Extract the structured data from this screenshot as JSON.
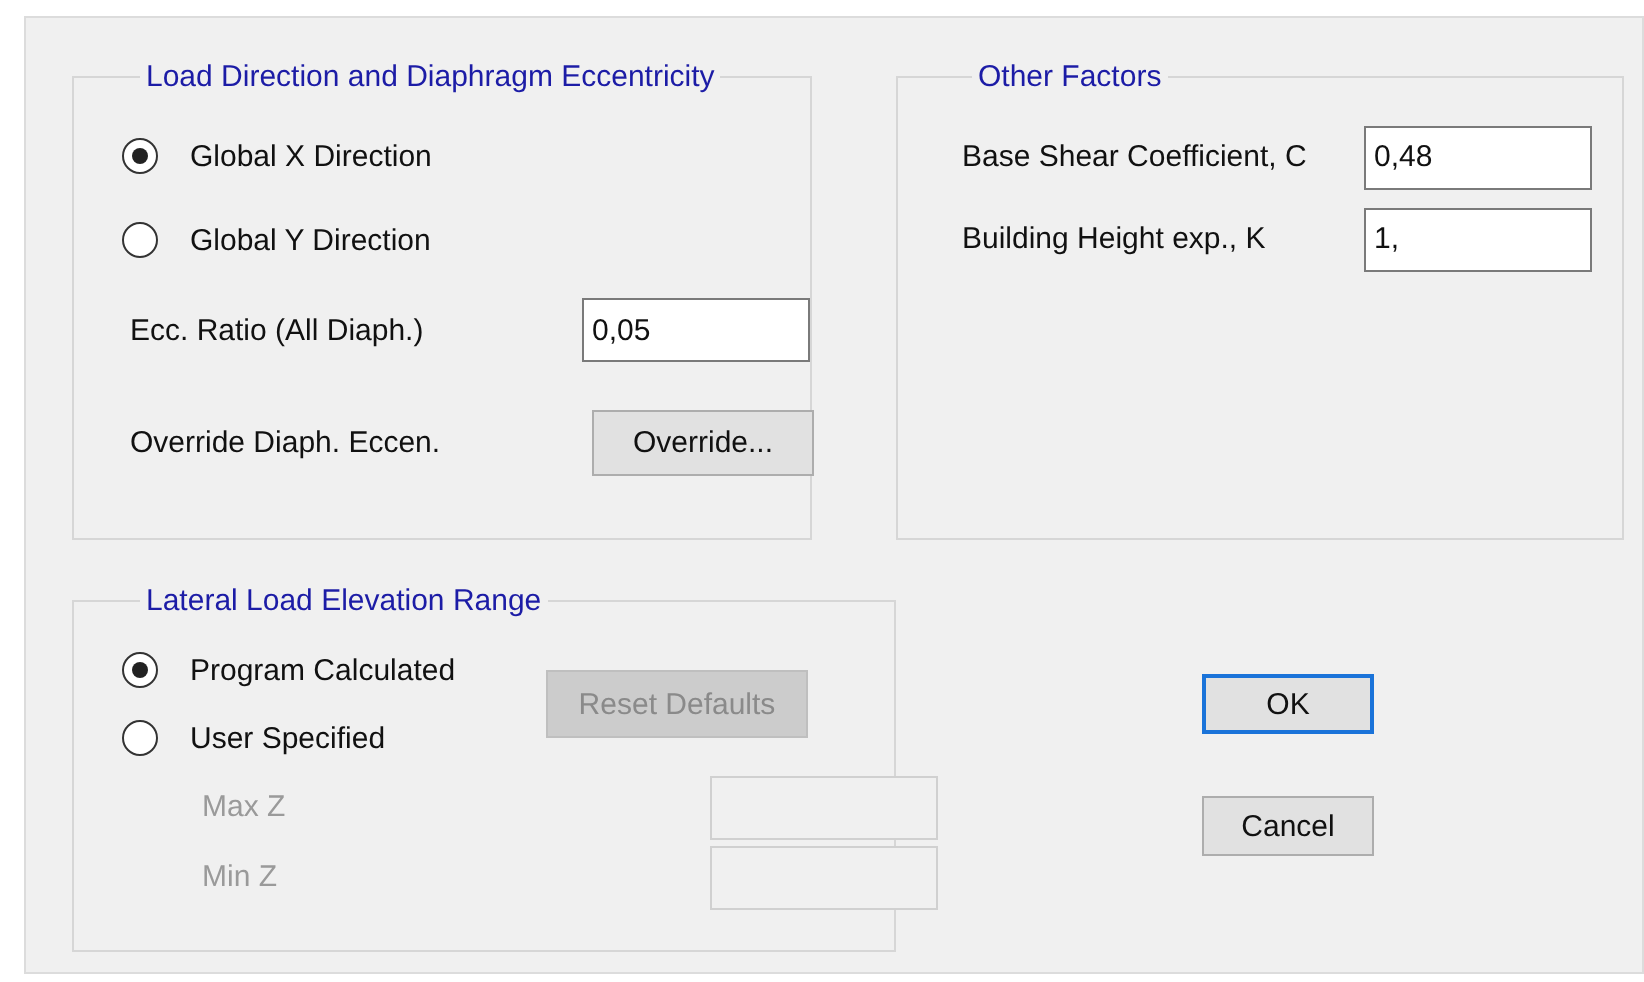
{
  "load_direction": {
    "title": "Load Direction and Diaphragm Eccentricity",
    "options": [
      {
        "label": "Global  X  Direction",
        "selected": true
      },
      {
        "label": "Global  Y  Direction",
        "selected": false
      }
    ],
    "ecc_ratio": {
      "label": "Ecc. Ratio (All Diaph.)",
      "value": "0,05"
    },
    "override": {
      "label": "Override Diaph. Eccen.",
      "button": "Override..."
    }
  },
  "other_factors": {
    "title": "Other Factors",
    "fields": [
      {
        "label": "Base Shear Coefficient, C",
        "value": "0,48"
      },
      {
        "label": "Building Height exp., K",
        "value": "1,"
      }
    ]
  },
  "elevation_range": {
    "title": "Lateral Load Elevation Range",
    "options": [
      {
        "label": "Program Calculated",
        "selected": true
      },
      {
        "label": "User Specified",
        "selected": false
      }
    ],
    "reset_button": {
      "label": "Reset Defaults",
      "disabled": true
    },
    "fields": [
      {
        "label": "Max Z",
        "disabled": true
      },
      {
        "label": "Min Z",
        "disabled": true
      }
    ]
  },
  "buttons": [
    {
      "label": "OK",
      "focused": true
    },
    {
      "label": "Cancel",
      "focused": false
    }
  ]
}
